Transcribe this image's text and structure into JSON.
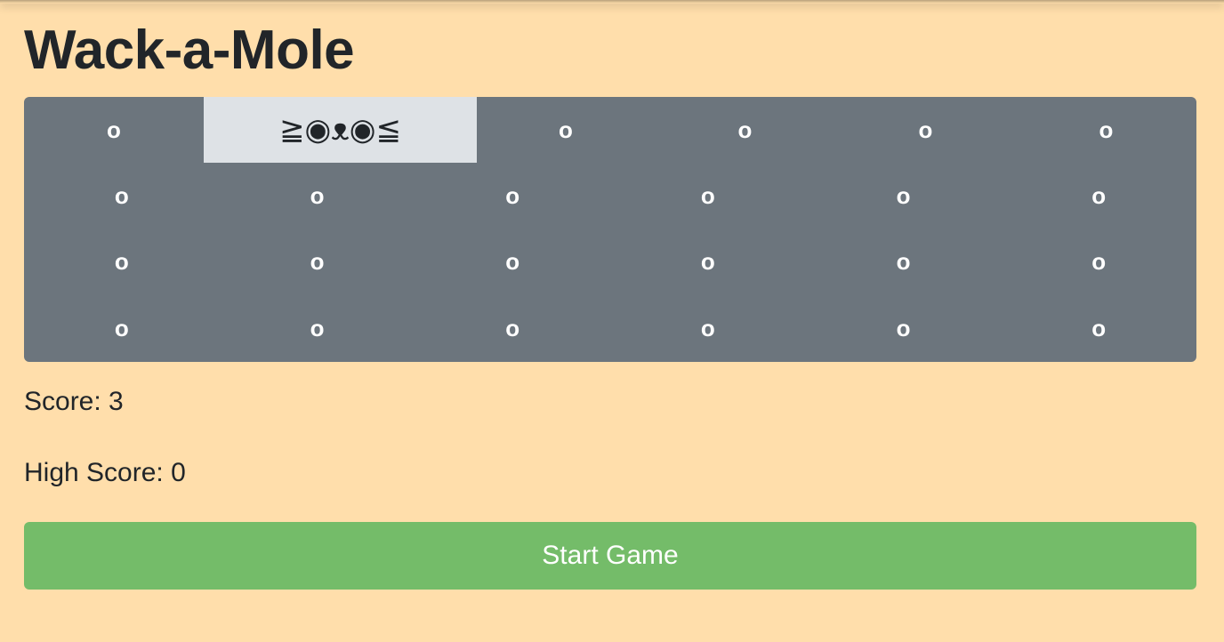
{
  "title": "Wack-a-Mole",
  "board": {
    "empty_symbol": "o",
    "mole_symbol": "≧◉ᴥ◉≦",
    "rows": [
      [
        "o",
        "≧◉ᴥ◉≦",
        "o",
        "o",
        "o",
        "o"
      ],
      [
        "o",
        "o",
        "o",
        "o",
        "o",
        "o"
      ],
      [
        "o",
        "o",
        "o",
        "o",
        "o",
        "o"
      ],
      [
        "o",
        "o",
        "o",
        "o",
        "o",
        "o"
      ]
    ],
    "active": {
      "row": 0,
      "col": 1
    }
  },
  "score": {
    "text": "Score: 3",
    "value": 3
  },
  "high_score": {
    "text": "High Score: 0",
    "value": 0
  },
  "start_button_label": "Start Game",
  "colors": {
    "background": "#ffdeab",
    "board": "#6c757d",
    "active_hole": "#dee2e6",
    "button": "#74bc69"
  }
}
